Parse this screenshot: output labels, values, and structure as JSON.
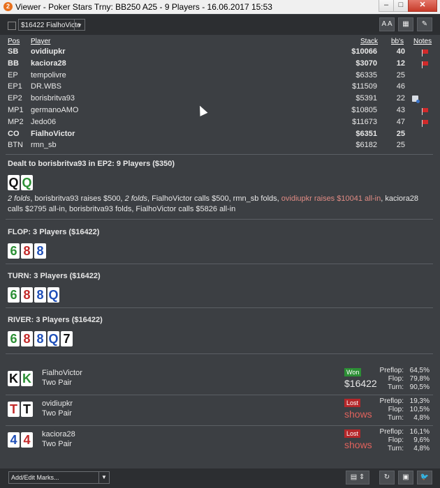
{
  "window": {
    "title": "Viewer - Poker Stars Trny: BB250 A25 - 9 Players - 16.06.2017 15:53",
    "app_icon": "pokertracker-icon",
    "buttons": [
      "minimize-icon",
      "maximize-icon",
      "close-icon"
    ]
  },
  "toolbar": {
    "filter_value": "$16422 FialhoVicto",
    "font_button": "A A",
    "grid_button": "grid-icon",
    "edit_button": "pencil-icon"
  },
  "table": {
    "headers": {
      "pos": "Pos",
      "player": "Player",
      "stack": "Stack",
      "bbs": "bb's",
      "notes": "Notes"
    },
    "rows": [
      {
        "pos": "SB",
        "player": "ovidiupkr",
        "stack": "$10066",
        "bbs": "40",
        "bold": true,
        "note": "flag"
      },
      {
        "pos": "BB",
        "player": "kaciora28",
        "stack": "$3070",
        "bbs": "12",
        "bold": true,
        "note": "flag"
      },
      {
        "pos": "EP",
        "player": "tempolivre",
        "stack": "$6335",
        "bbs": "25",
        "bold": false,
        "note": ""
      },
      {
        "pos": "EP1",
        "player": "DR.WBS",
        "stack": "$11509",
        "bbs": "46",
        "bold": false,
        "note": ""
      },
      {
        "pos": "EP2",
        "player": "borisbritva93",
        "stack": "$5391",
        "bbs": "22",
        "bold": false,
        "note": "note-icon"
      },
      {
        "pos": "MP1",
        "player": "germanoAMO",
        "stack": "$10805",
        "bbs": "43",
        "bold": false,
        "note": "flag"
      },
      {
        "pos": "MP2",
        "player": "Jedo06",
        "stack": "$11673",
        "bbs": "47",
        "bold": false,
        "note": "flag"
      },
      {
        "pos": "CO",
        "player": "FialhoVictor",
        "stack": "$6351",
        "bbs": "25",
        "bold": true,
        "note": ""
      },
      {
        "pos": "BTN",
        "player": "rmn_sb",
        "stack": "$6182",
        "bbs": "25",
        "bold": false,
        "note": ""
      }
    ]
  },
  "dealt": {
    "title": "Dealt to borisbritva93 in EP2: 9 Players ($350)",
    "cards": [
      {
        "rank": "Q",
        "color": "black"
      },
      {
        "rank": "Q",
        "color": "green"
      }
    ],
    "actions": [
      {
        "text": "2 folds",
        "style": "em"
      },
      {
        "text": ", borisbritva93 raises $500, ",
        "style": ""
      },
      {
        "text": "2 folds",
        "style": "em"
      },
      {
        "text": ", FialhoVictor calls $500, rmn_sb folds, ",
        "style": ""
      },
      {
        "text": "ovidiupkr raises $10041 all-in",
        "style": "alert"
      },
      {
        "text": ", kaciora28 calls $2795 all-in, borisbritva93 folds, FialhoVictor calls $5826 all-in",
        "style": ""
      }
    ]
  },
  "flop": {
    "title": "FLOP: 3 Players ($16422)",
    "cards": [
      {
        "rank": "6",
        "color": "green"
      },
      {
        "rank": "8",
        "color": "red"
      },
      {
        "rank": "8",
        "color": "blue"
      }
    ]
  },
  "turn": {
    "title": "TURN: 3 Players ($16422)",
    "cards": [
      {
        "rank": "6",
        "color": "green"
      },
      {
        "rank": "8",
        "color": "red"
      },
      {
        "rank": "8",
        "color": "blue"
      },
      {
        "rank": "Q",
        "color": "blue"
      }
    ]
  },
  "river": {
    "title": "RIVER: 3 Players ($16422)",
    "cards": [
      {
        "rank": "6",
        "color": "green"
      },
      {
        "rank": "8",
        "color": "red"
      },
      {
        "rank": "8",
        "color": "blue"
      },
      {
        "rank": "Q",
        "color": "blue"
      },
      {
        "rank": "7",
        "color": "black"
      }
    ]
  },
  "results": [
    {
      "player": "FialhoVictor",
      "hand": "Two Pair",
      "cards": [
        {
          "rank": "K",
          "color": "black"
        },
        {
          "rank": "K",
          "color": "green"
        }
      ],
      "badge": "Won",
      "badge_type": "won",
      "amount": "$16422",
      "stats": [
        {
          "label": "Preflop:",
          "value": "64,5%"
        },
        {
          "label": "Flop:",
          "value": "79,8%"
        },
        {
          "label": "Turn:",
          "value": "90,5%"
        }
      ]
    },
    {
      "player": "ovidiupkr",
      "hand": "Two Pair",
      "cards": [
        {
          "rank": "T",
          "color": "red"
        },
        {
          "rank": "T",
          "color": "black"
        }
      ],
      "badge": "Lost",
      "badge_type": "lost",
      "amount": "shows",
      "stats": [
        {
          "label": "Preflop:",
          "value": "19,3%"
        },
        {
          "label": "Flop:",
          "value": "10,5%"
        },
        {
          "label": "Turn:",
          "value": "4,8%"
        }
      ]
    },
    {
      "player": "kaciora28",
      "hand": "Two Pair",
      "cards": [
        {
          "rank": "4",
          "color": "blue"
        },
        {
          "rank": "4",
          "color": "red"
        }
      ],
      "badge": "Lost",
      "badge_type": "lost",
      "amount": "shows",
      "stats": [
        {
          "label": "Preflop:",
          "value": "16,1%"
        },
        {
          "label": "Flop:",
          "value": "9,6%"
        },
        {
          "label": "Turn:",
          "value": "4,8%"
        }
      ]
    }
  ],
  "bottom": {
    "marks_placeholder": "Add/Edit Marks..."
  },
  "colors": {
    "background": "#3c3f43",
    "bar": "#2c2e31",
    "won": "#2c8f35",
    "lost": "#b5272a",
    "highlight": "#e08b84"
  }
}
